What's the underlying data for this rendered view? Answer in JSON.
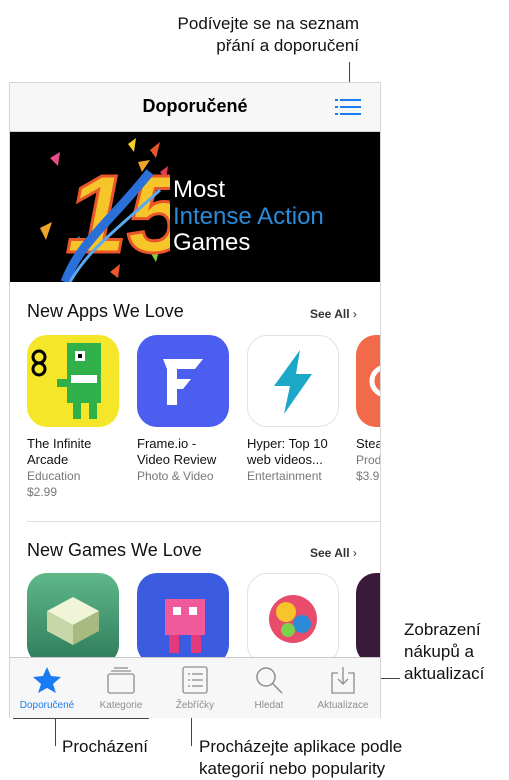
{
  "callouts": {
    "top_line1": "Podívejte se na seznam",
    "top_line2": "přání a doporučení",
    "right_line1": "Zobrazení",
    "right_line2": "nákupů a",
    "right_line3": "aktualizací",
    "bottom_left": "Procházení",
    "bottom_right_line1": "Procházejte aplikace podle",
    "bottom_right_line2": "kategorií nebo popularity"
  },
  "navbar": {
    "title": "Doporučené",
    "list_icon": "list-icon"
  },
  "banner": {
    "number": "15",
    "line1": "Most",
    "line2": "Intense Action",
    "line3": "Games"
  },
  "sections": [
    {
      "title": "New Apps We Love",
      "see_all": "See All",
      "apps": [
        {
          "name": "The Infinite",
          "name2": "Arcade",
          "category": "Education",
          "price": "$2.99"
        },
        {
          "name": "Frame.io -",
          "name2": "Video Review",
          "category": "Photo & Video",
          "price": ""
        },
        {
          "name": "Hyper: Top 10",
          "name2": "web videos...",
          "category": "Entertainment",
          "price": ""
        },
        {
          "name": "Stea",
          "name2": "",
          "category": "Prod",
          "price": "$3.9"
        }
      ]
    },
    {
      "title": "New Games We Love",
      "see_all": "See All"
    }
  ],
  "tabbar": {
    "items": [
      {
        "label": "Doporučené",
        "icon": "star-icon",
        "active": true
      },
      {
        "label": "Kategorie",
        "icon": "stack-icon",
        "active": false
      },
      {
        "label": "Žebříčky",
        "icon": "list-icon",
        "active": false
      },
      {
        "label": "Hledat",
        "icon": "search-icon",
        "active": false
      },
      {
        "label": "Aktualizace",
        "icon": "download-icon",
        "active": false
      }
    ]
  },
  "colors": {
    "accent": "#1a7cf5",
    "banner_blue": "#2b8bd8"
  }
}
